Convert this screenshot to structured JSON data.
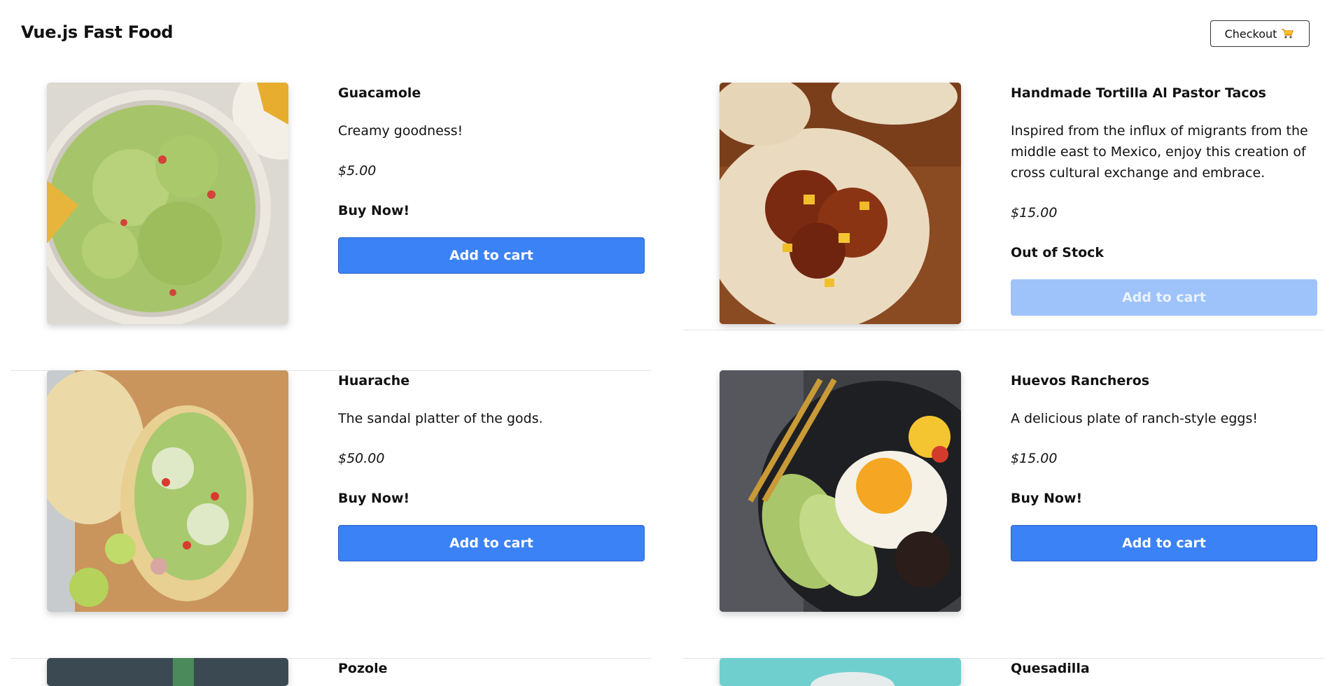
{
  "header": {
    "title": "Vue.js Fast Food",
    "checkout_label": "Checkout",
    "checkout_icon": "cart-icon"
  },
  "products": [
    {
      "name": "Guacamole",
      "description": "Creamy goodness!",
      "price": "$5.00",
      "status": "Buy Now!",
      "button": "Add to cart",
      "in_stock": true
    },
    {
      "name": "Handmade Tortilla Al Pastor Tacos",
      "description": "Inspired from the influx of migrants from the middle east to Mexico, enjoy this creation of cross cultural exchange and embrace.",
      "price": "$15.00",
      "status": "Out of Stock",
      "button": "Add to cart",
      "in_stock": false
    },
    {
      "name": "Huarache",
      "description": "The sandal platter of the gods.",
      "price": "$50.00",
      "status": "Buy Now!",
      "button": "Add to cart",
      "in_stock": true
    },
    {
      "name": "Huevos Rancheros",
      "description": "A delicious plate of ranch-style eggs!",
      "price": "$15.00",
      "status": "Buy Now!",
      "button": "Add to cart",
      "in_stock": true
    },
    {
      "name": "Pozole"
    },
    {
      "name": "Quesadilla"
    }
  ],
  "colors": {
    "button": "#3b82f6",
    "button_disabled": "#9ec3fa"
  }
}
